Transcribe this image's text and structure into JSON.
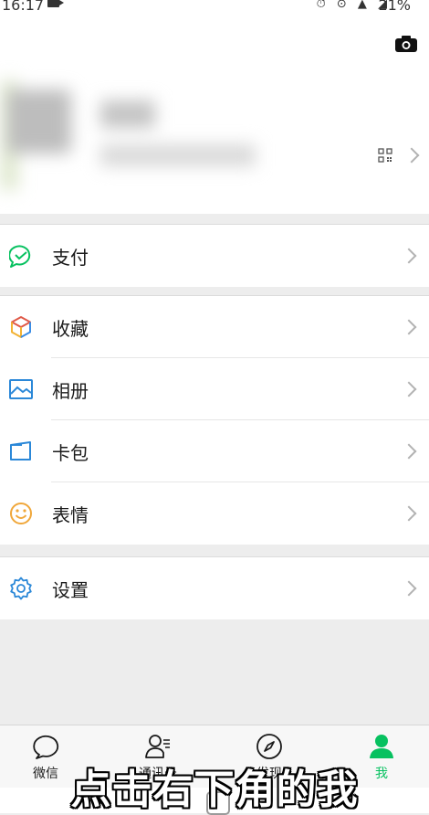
{
  "status_bar": {
    "time": "16:17",
    "battery": "21%"
  },
  "profile": {},
  "menu": {
    "pay": "支付",
    "favorites": "收藏",
    "album": "相册",
    "cards": "卡包",
    "stickers": "表情",
    "settings": "设置"
  },
  "tabs": [
    {
      "label": "微信"
    },
    {
      "label": "通讯录"
    },
    {
      "label": "发现"
    },
    {
      "label": "我"
    }
  ],
  "overlay": {
    "subtitle": "点击右下角的我"
  },
  "colors": {
    "accent": "#07c160",
    "background": "#ededed"
  }
}
